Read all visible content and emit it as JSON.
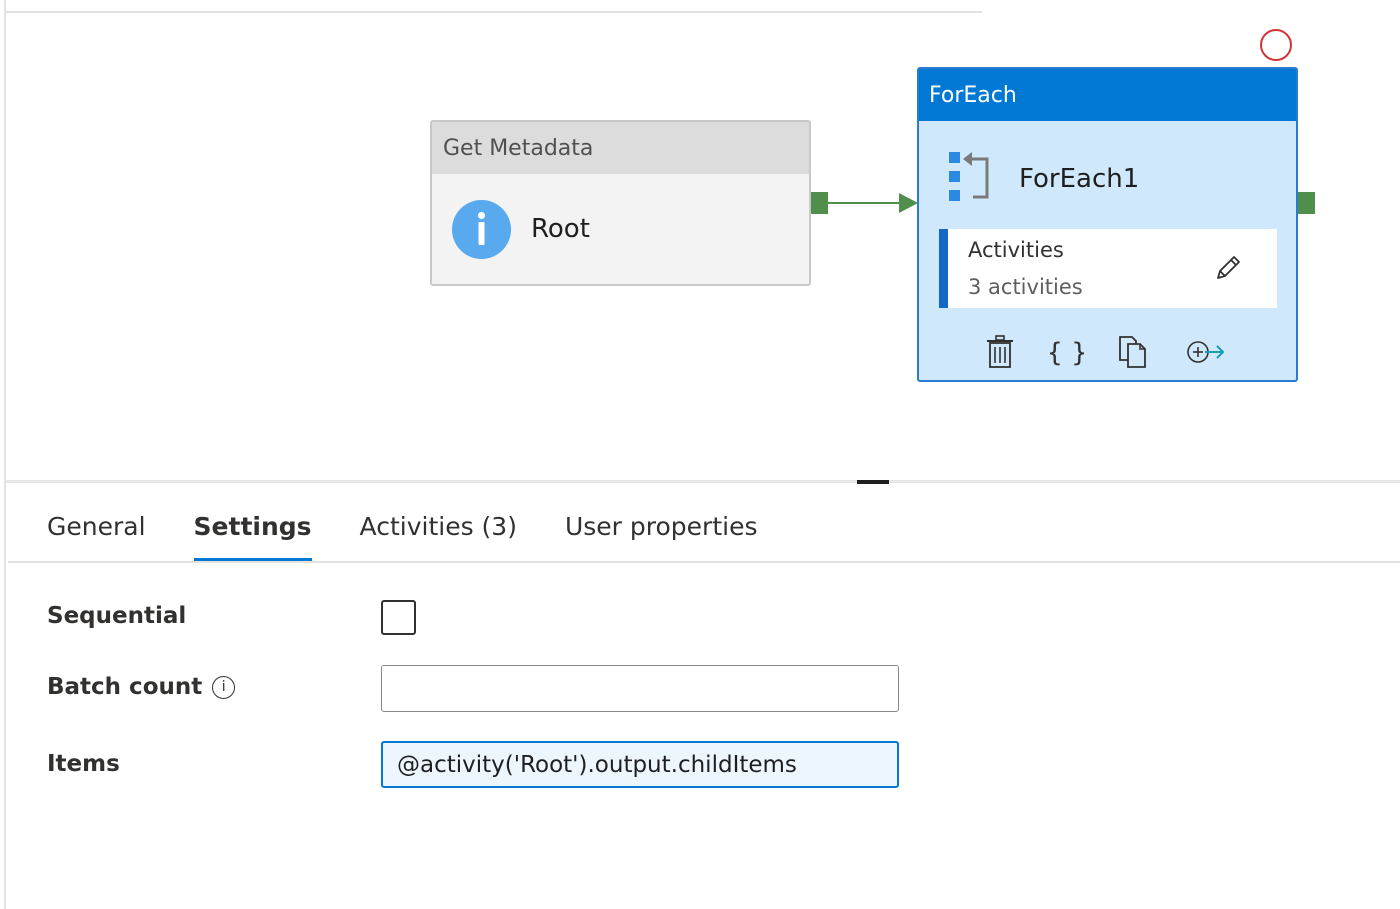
{
  "canvas": {
    "get_metadata": {
      "type_label": "Get Metadata",
      "name": "Root",
      "icon": "info-icon"
    },
    "foreach": {
      "type_label": "ForEach",
      "name": "ForEach1",
      "icon": "foreach-icon",
      "activities_title": "Activities",
      "activities_count": "3 activities",
      "toolbar_icons": [
        "delete-icon",
        "code-icon",
        "copy-icon",
        "add-output-icon"
      ]
    },
    "colors": {
      "success_green": "#4f8f4b",
      "foreach_blue": "#0078d4",
      "error_red": "#d13438"
    }
  },
  "tabs": [
    {
      "label": "General",
      "active": false
    },
    {
      "label": "Settings",
      "active": true
    },
    {
      "label": "Activities (3)",
      "active": false
    },
    {
      "label": "User properties",
      "active": false
    }
  ],
  "settings": {
    "sequential_label": "Sequential",
    "sequential_checked": false,
    "batch_count_label": "Batch count",
    "batch_count_value": "",
    "items_label": "Items",
    "items_value": "@activity('Root').output.childItems"
  }
}
